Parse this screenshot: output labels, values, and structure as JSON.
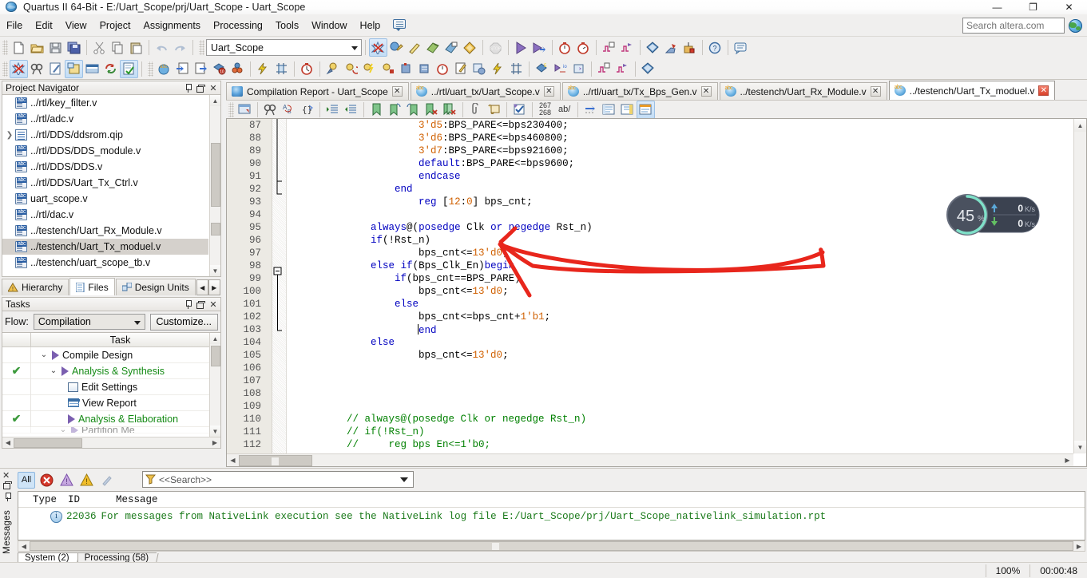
{
  "window": {
    "title": "Quartus II 64-Bit - E:/Uart_Scope/prj/Uart_Scope - Uart_Scope",
    "minimize": "—",
    "maximize": "❐",
    "close": "✕"
  },
  "menubar": {
    "items": [
      "File",
      "Edit",
      "View",
      "Project",
      "Assignments",
      "Processing",
      "Tools",
      "Window",
      "Help"
    ],
    "search_placeholder": "Search altera.com"
  },
  "toolbar": {
    "project_combo_value": "Uart_Scope"
  },
  "project_navigator": {
    "title": "Project Navigator",
    "files": [
      {
        "label": "../rtl/key_filter.v",
        "icon": "verilog-file-icon",
        "expandable": false,
        "selected": false
      },
      {
        "label": "../rtl/adc.v",
        "icon": "verilog-file-icon",
        "expandable": false,
        "selected": false
      },
      {
        "label": "../rtl/DDS/ddsrom.qip",
        "icon": "qip-file-icon",
        "expandable": true,
        "selected": false
      },
      {
        "label": "../rtl/DDS/DDS_module.v",
        "icon": "verilog-file-icon",
        "expandable": false,
        "selected": false
      },
      {
        "label": "../rtl/DDS/DDS.v",
        "icon": "verilog-file-icon",
        "expandable": false,
        "selected": false
      },
      {
        "label": "../rtl/DDS/Uart_Tx_Ctrl.v",
        "icon": "verilog-file-icon",
        "expandable": false,
        "selected": false
      },
      {
        "label": "uart_scope.v",
        "icon": "verilog-file-icon",
        "expandable": false,
        "selected": false
      },
      {
        "label": "../rtl/dac.v",
        "icon": "verilog-file-icon",
        "expandable": false,
        "selected": false
      },
      {
        "label": "../testench/Uart_Rx_Module.v",
        "icon": "verilog-file-icon",
        "expandable": false,
        "selected": false
      },
      {
        "label": "../testench/Uart_Tx_moduel.v",
        "icon": "verilog-file-icon",
        "expandable": false,
        "selected": true
      },
      {
        "label": "../testench/uart_scope_tb.v",
        "icon": "verilog-file-icon",
        "expandable": false,
        "selected": false
      }
    ],
    "tabs": [
      {
        "label": "Hierarchy",
        "icon": "hierarchy-icon",
        "active": false
      },
      {
        "label": "Files",
        "icon": "files-icon",
        "active": true
      },
      {
        "label": "Design Units",
        "icon": "design-units-icon",
        "active": false
      }
    ]
  },
  "tasks": {
    "title": "Tasks",
    "flow_label": "Flow:",
    "flow_value": "Compilation",
    "customize_label": "Customize...",
    "column_header": "Task",
    "rows": [
      {
        "name": "Compile Design",
        "done": false,
        "green": false,
        "indent": 1,
        "chevron": "⌄",
        "icon": "play-icon"
      },
      {
        "name": "Analysis & Synthesis",
        "done": true,
        "green": true,
        "indent": 2,
        "chevron": "⌄",
        "icon": "play-icon"
      },
      {
        "name": "Edit Settings",
        "done": false,
        "green": false,
        "indent": 3,
        "chevron": "",
        "icon": "settings-icon"
      },
      {
        "name": "View Report",
        "done": false,
        "green": false,
        "indent": 3,
        "chevron": "",
        "icon": "report-icon"
      },
      {
        "name": "Analysis & Elaboration",
        "done": true,
        "green": true,
        "indent": 3,
        "chevron": "",
        "icon": "play-icon"
      },
      {
        "name": "Partition Me",
        "done": false,
        "green": false,
        "indent": 3,
        "chevron": "⌄",
        "icon": "play-icon"
      }
    ]
  },
  "editor": {
    "tabs": [
      {
        "label": "Compilation Report - Uart_Scope",
        "icon": "report-tab-icon",
        "active": false,
        "close_red": false
      },
      {
        "label": "../rtl/uart_tx/Uart_Scope.v",
        "icon": "verilog-tab-icon",
        "active": false,
        "close_red": false
      },
      {
        "label": "../rtl/uart_tx/Tx_Bps_Gen.v",
        "icon": "verilog-tab-icon",
        "active": false,
        "close_red": false
      },
      {
        "label": "../testench/Uart_Rx_Module.v",
        "icon": "verilog-tab-icon",
        "active": false,
        "close_red": false
      },
      {
        "label": "../testench/Uart_Tx_moduel.v",
        "icon": "verilog-tab-icon",
        "active": true,
        "close_red": true
      }
    ],
    "toolbar_counter_top": "267",
    "toolbar_counter_bottom": "268",
    "toolbar_ab": "ab/",
    "first_line": 87,
    "lines": [
      {
        "num": 87,
        "indent": 22,
        "tokens": [
          {
            "t": "3'd5",
            "c": "n"
          },
          {
            "t": ":BPS_PARE<=bps230400;",
            "c": "p"
          }
        ]
      },
      {
        "num": 88,
        "indent": 22,
        "tokens": [
          {
            "t": "3'd6",
            "c": "n"
          },
          {
            "t": ":BPS_PARE<=bps460800;",
            "c": "p"
          }
        ]
      },
      {
        "num": 89,
        "indent": 22,
        "tokens": [
          {
            "t": "3'd7",
            "c": "n"
          },
          {
            "t": ":BPS_PARE<=bps921600;",
            "c": "p"
          }
        ]
      },
      {
        "num": 90,
        "indent": 22,
        "tokens": [
          {
            "t": "default",
            "c": "k"
          },
          {
            "t": ":BPS_PARE<=bps9600;",
            "c": "p"
          }
        ]
      },
      {
        "num": 91,
        "indent": 22,
        "tokens": [
          {
            "t": "endcase",
            "c": "k"
          }
        ]
      },
      {
        "num": 92,
        "indent": 18,
        "tokens": [
          {
            "t": "end",
            "c": "k"
          }
        ]
      },
      {
        "num": 93,
        "indent": 22,
        "tokens": [
          {
            "t": "reg",
            "c": "k"
          },
          {
            "t": " [",
            "c": "p"
          },
          {
            "t": "12",
            "c": "n"
          },
          {
            "t": ":",
            "c": "p"
          },
          {
            "t": "0",
            "c": "n"
          },
          {
            "t": "] bps_cnt;",
            "c": "p"
          }
        ]
      },
      {
        "num": 94,
        "indent": 0,
        "tokens": []
      },
      {
        "num": 95,
        "indent": 14,
        "tokens": [
          {
            "t": "always",
            "c": "k"
          },
          {
            "t": "@(",
            "c": "p"
          },
          {
            "t": "posedge",
            "c": "k"
          },
          {
            "t": " Clk ",
            "c": "p"
          },
          {
            "t": "or",
            "c": "k"
          },
          {
            "t": " ",
            "c": "p"
          },
          {
            "t": "negedge",
            "c": "k"
          },
          {
            "t": " Rst_n)",
            "c": "p"
          }
        ]
      },
      {
        "num": 96,
        "indent": 14,
        "tokens": [
          {
            "t": "if",
            "c": "k"
          },
          {
            "t": "(!Rst_n)",
            "c": "p"
          }
        ]
      },
      {
        "num": 97,
        "indent": 22,
        "tokens": [
          {
            "t": "bps_cnt<=",
            "c": "p"
          },
          {
            "t": "13'd0",
            "c": "n"
          },
          {
            "t": ";",
            "c": "p"
          }
        ]
      },
      {
        "num": 98,
        "indent": 14,
        "tokens": [
          {
            "t": "else",
            "c": "k"
          },
          {
            "t": " ",
            "c": "p"
          },
          {
            "t": "if",
            "c": "k"
          },
          {
            "t": "(Bps_Clk_En)",
            "c": "p"
          },
          {
            "t": "begin",
            "c": "k"
          }
        ],
        "fold": "minus"
      },
      {
        "num": 99,
        "indent": 18,
        "tokens": [
          {
            "t": "if",
            "c": "k"
          },
          {
            "t": "(bps_cnt==BPS_PARE)",
            "c": "p"
          }
        ]
      },
      {
        "num": 100,
        "indent": 22,
        "tokens": [
          {
            "t": "bps_cnt<=",
            "c": "p"
          },
          {
            "t": "13'd0",
            "c": "n"
          },
          {
            "t": ";",
            "c": "p"
          }
        ]
      },
      {
        "num": 101,
        "indent": 18,
        "tokens": [
          {
            "t": "else",
            "c": "k"
          }
        ]
      },
      {
        "num": 102,
        "indent": 22,
        "tokens": [
          {
            "t": "bps_cnt<=bps_cnt+",
            "c": "p"
          },
          {
            "t": "1'b1",
            "c": "n"
          },
          {
            "t": ";",
            "c": "p"
          }
        ]
      },
      {
        "num": 103,
        "indent": 22,
        "tokens": [
          {
            "t": "end",
            "c": "k"
          }
        ],
        "caret": true
      },
      {
        "num": 104,
        "indent": 14,
        "tokens": [
          {
            "t": "else",
            "c": "k"
          }
        ]
      },
      {
        "num": 105,
        "indent": 22,
        "tokens": [
          {
            "t": "bps_cnt<=",
            "c": "p"
          },
          {
            "t": "13'd0",
            "c": "n"
          },
          {
            "t": ";",
            "c": "p"
          }
        ]
      },
      {
        "num": 106,
        "indent": 0,
        "tokens": []
      },
      {
        "num": 107,
        "indent": 0,
        "tokens": []
      },
      {
        "num": 108,
        "indent": 0,
        "tokens": []
      },
      {
        "num": 109,
        "indent": 0,
        "tokens": []
      },
      {
        "num": 110,
        "indent": 10,
        "tokens": [
          {
            "t": "// always@(posedge Clk or negedge Rst_n)",
            "c": "c"
          }
        ]
      },
      {
        "num": 111,
        "indent": 10,
        "tokens": [
          {
            "t": "// if(!Rst_n)",
            "c": "c"
          }
        ]
      },
      {
        "num": 112,
        "indent": 10,
        "tokens": [
          {
            "t": "//     reg bps En<=1'b0;",
            "c": "c"
          }
        ]
      }
    ]
  },
  "messages": {
    "side_label": "Messages",
    "filter_all_label": "All",
    "search_placeholder": "<<Search>>",
    "columns": [
      "Type",
      "ID",
      "Message"
    ],
    "rows": [
      {
        "type": "info",
        "id": "22036",
        "message": "For messages from NativeLink execution see the NativeLink log file E:/Uart_Scope/prj/Uart_Scope_nativelink_simulation.rpt"
      }
    ],
    "tabs": [
      {
        "label": "System (2)",
        "active": true
      },
      {
        "label": "Processing (58)",
        "active": false
      }
    ]
  },
  "statusbar": {
    "zoom": "100%",
    "elapsed": "00:00:48"
  },
  "perf_widget": {
    "cpu_value": "45",
    "cpu_unit": "%",
    "upload": "0",
    "upload_unit": "K/s",
    "download": "0",
    "download_unit": "K/s",
    "ring_color": "#7fe0c8",
    "panel_color": "#3b4250"
  },
  "annotation": {
    "color": "#e8261c",
    "shape": "hand-drawn-arrow"
  }
}
